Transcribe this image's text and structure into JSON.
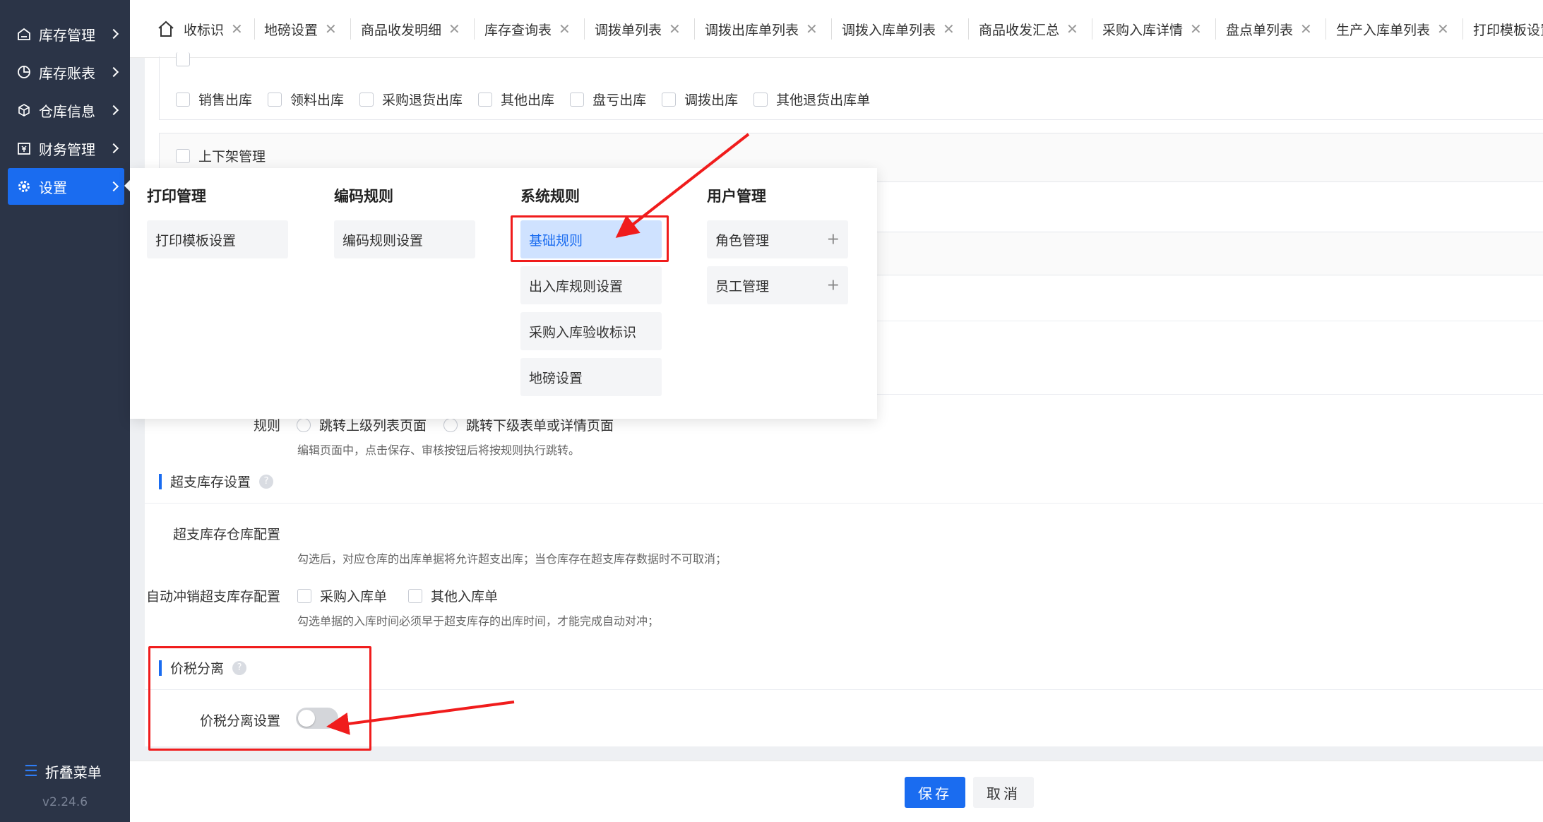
{
  "sidebar": {
    "items": [
      {
        "label": "库存管理",
        "icon": "warehouse-icon"
      },
      {
        "label": "库存账表",
        "icon": "pie-chart-icon"
      },
      {
        "label": "仓库信息",
        "icon": "cube-icon"
      },
      {
        "label": "财务管理",
        "icon": "finance-icon"
      },
      {
        "label": "设置",
        "icon": "gear-icon"
      }
    ],
    "collapse_label": "折叠菜单",
    "version": "v2.24.6"
  },
  "tabs": [
    "收标识",
    "地磅设置",
    "商品收发明细",
    "库存查询表",
    "调拨单列表",
    "调拨出库单列表",
    "调拨入库单列表",
    "商品收发汇总",
    "采购入库详情",
    "盘点单列表",
    "生产入库单列表",
    "打印模板设置"
  ],
  "content": {
    "outbound_options": [
      "销售出库",
      "领料出库",
      "采购退货出库",
      "其他出库",
      "盘亏出库",
      "调拨出库",
      "其他退货出库单"
    ],
    "shelf_label": "上下架管理",
    "jump_rule_label": "规则",
    "jump_options": [
      "跳转上级列表页面",
      "跳转下级表单或详情页面"
    ],
    "jump_hint": "编辑页面中，点击保存、审核按钮后将按规则执行跳转。",
    "overdraw_section": "超支库存设置",
    "overdraw_wh_label": "超支库存仓库配置",
    "overdraw_wh_hint": "勾选后，对应仓库的出库单据将允许超支出库；当仓库存在超支库存数据时不可取消；",
    "auto_offset_label": "自动冲销超支库存配置",
    "auto_offset_options": [
      "采购入库单",
      "其他入库单"
    ],
    "auto_offset_hint": "勾选单据的入库时间必须早于超支库存的出库时间，才能完成自动对冲；",
    "tax_section": "价税分离",
    "tax_setting_label": "价税分离设置",
    "tax_switch_on": false
  },
  "footer": {
    "save": "保存",
    "cancel": "取消"
  },
  "flyout": {
    "columns": [
      {
        "title": "打印管理",
        "items": [
          {
            "label": "打印模板设置"
          }
        ]
      },
      {
        "title": "编码规则",
        "items": [
          {
            "label": "编码规则设置"
          }
        ]
      },
      {
        "title": "系统规则",
        "items": [
          {
            "label": "基础规则",
            "selected": true
          },
          {
            "label": "出入库规则设置"
          },
          {
            "label": "采购入库验收标识"
          },
          {
            "label": "地磅设置"
          }
        ]
      },
      {
        "title": "用户管理",
        "items": [
          {
            "label": "角色管理",
            "expandable": true
          },
          {
            "label": "员工管理",
            "expandable": true
          }
        ]
      }
    ]
  },
  "colors": {
    "accent": "#1a6cf0",
    "sidebar": "#2b3447",
    "annotation": "#f01c1c"
  }
}
